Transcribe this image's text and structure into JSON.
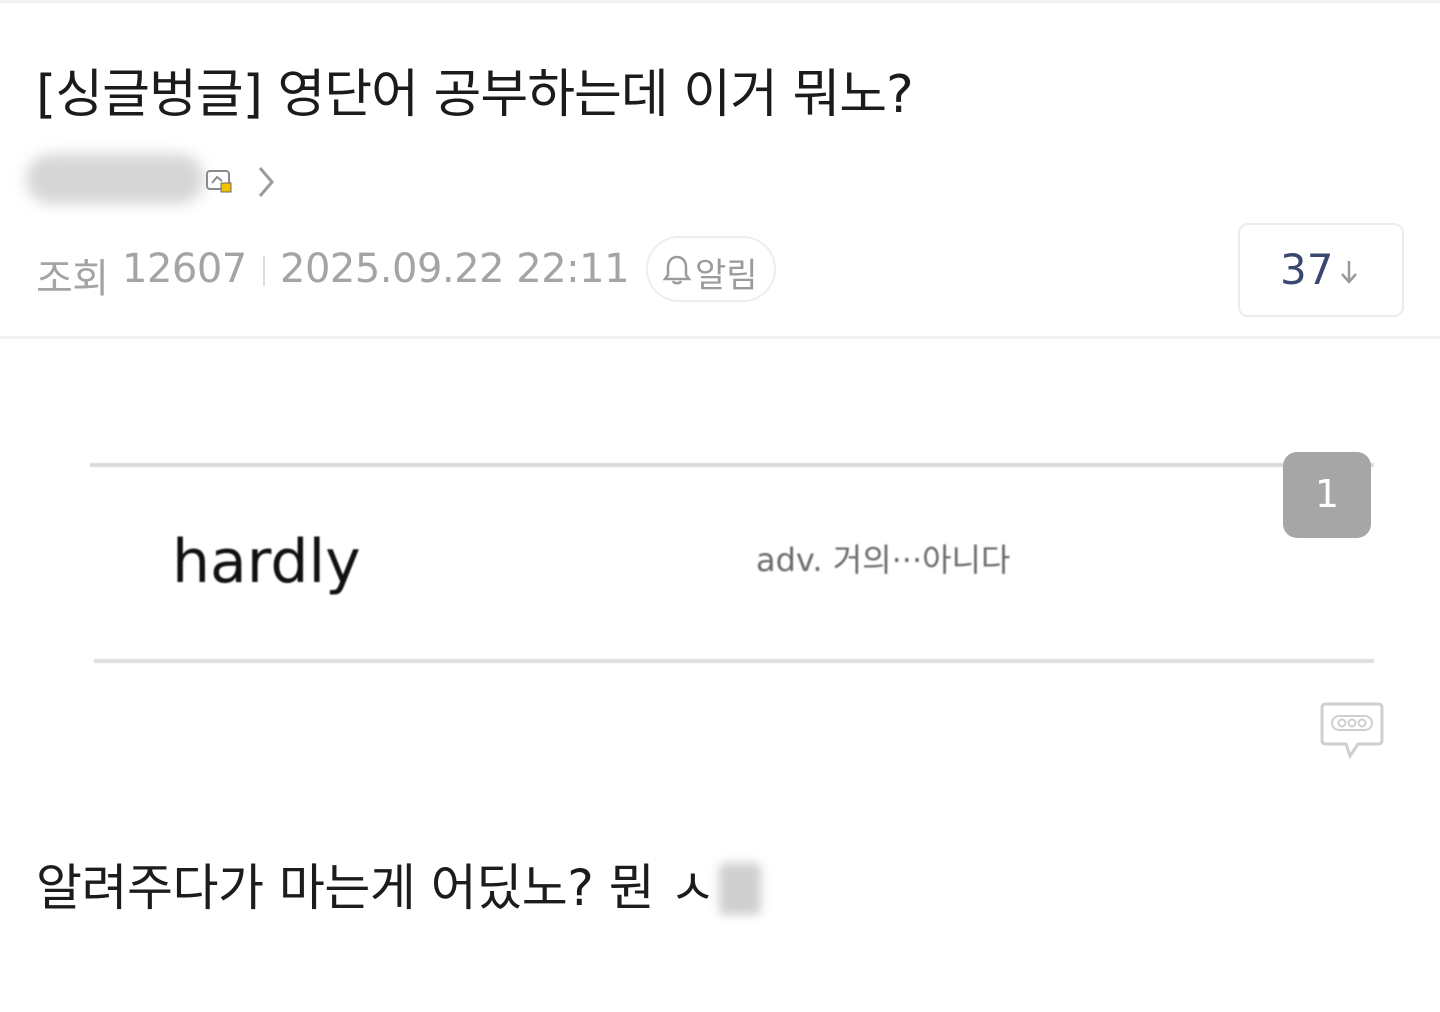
{
  "post": {
    "title": "[싱글벙글] 영단어 공부하는데 이거 뭐노?",
    "author_icon": "level-badge-icon",
    "meta": {
      "views_label": "조회",
      "views": "12607",
      "date": "2025.09.22 22:11",
      "alarm_label": "알림"
    },
    "comment_count": "37",
    "body_text": "알려주다가 마는게 어딨노? 뭔 ㅅ"
  },
  "image": {
    "word": "hardly",
    "meaning": "adv. 거의···아니다",
    "index_badge": "1"
  },
  "icons": {
    "author_chevron": "chevron-right-icon",
    "alarm": "bell-icon",
    "sort": "down-arrow-icon",
    "image_comment": "speech-bubble-icon"
  },
  "colors": {
    "meta_text": "#a4a4a4",
    "comment_count": "#3a4870",
    "badge_bg": "#a6a6a6"
  }
}
